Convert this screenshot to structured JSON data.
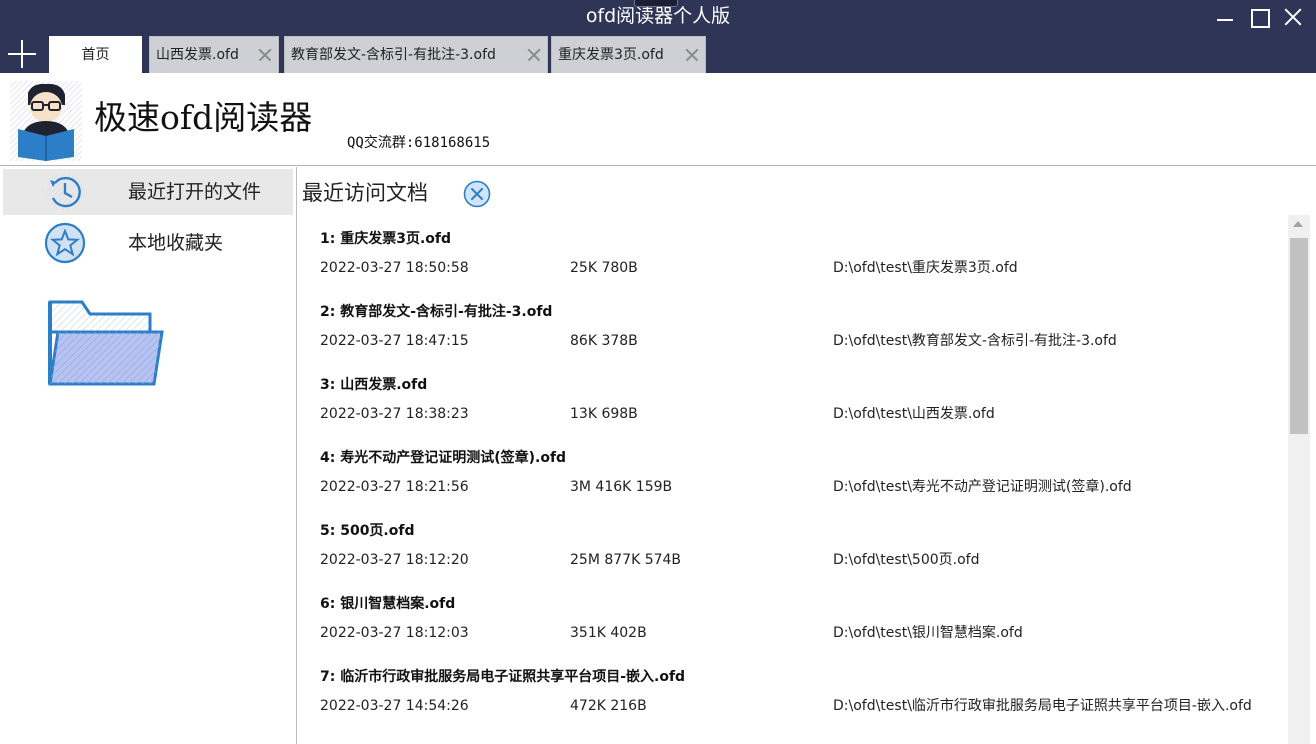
{
  "window": {
    "title": "ofd阅读器个人版"
  },
  "tabs": [
    {
      "label": "首页",
      "active": true
    },
    {
      "label": "山西发票.ofd",
      "active": false
    },
    {
      "label": "教育部发文-含标引-有批注-3.ofd",
      "active": false
    },
    {
      "label": "重庆发票3页.ofd",
      "active": false
    }
  ],
  "brand": {
    "app_name": "极速ofd阅读器",
    "qq_group": "QQ交流群:618168615"
  },
  "sidebar": {
    "items": [
      {
        "label": "最近打开的文件",
        "icon": "recent-clock-icon",
        "selected": true
      },
      {
        "label": "本地收藏夹",
        "icon": "star-icon",
        "selected": false
      }
    ],
    "folder_icon": "open-folder-icon"
  },
  "main": {
    "title": "最近访问文档",
    "clear_icon": "clear-circle-x-icon"
  },
  "recent_files": [
    {
      "title": "1: 重庆发票3页.ofd",
      "time": "2022-03-27 18:50:58",
      "size": "25K 780B",
      "path": "D:\\ofd\\test\\重庆发票3页.ofd"
    },
    {
      "title": "2: 教育部发文-含标引-有批注-3.ofd",
      "time": "2022-03-27 18:47:15",
      "size": "86K 378B",
      "path": "D:\\ofd\\test\\教育部发文-含标引-有批注-3.ofd"
    },
    {
      "title": "3: 山西发票.ofd",
      "time": "2022-03-27 18:38:23",
      "size": "13K 698B",
      "path": "D:\\ofd\\test\\山西发票.ofd"
    },
    {
      "title": "4: 寿光不动产登记证明测试(签章).ofd",
      "time": "2022-03-27 18:21:56",
      "size": "3M 416K 159B",
      "path": "D:\\ofd\\test\\寿光不动产登记证明测试(签章).ofd"
    },
    {
      "title": "5: 500页.ofd",
      "time": "2022-03-27 18:12:20",
      "size": "25M 877K 574B",
      "path": "D:\\ofd\\test\\500页.ofd"
    },
    {
      "title": "6: 银川智慧档案.ofd",
      "time": "2022-03-27 18:12:03",
      "size": "351K 402B",
      "path": "D:\\ofd\\test\\银川智慧档案.ofd"
    },
    {
      "title": "7: 临沂市行政审批服务局电子证照共享平台项目-嵌入.ofd",
      "time": "2022-03-27 14:54:26",
      "size": "472K 216B",
      "path": "D:\\ofd\\test\\临沂市行政审批服务局电子证照共享平台项目-嵌入.ofd"
    }
  ],
  "colors": {
    "titlebar": "#2e3557",
    "tab_inactive": "#cfd0d6",
    "tab_active": "#ffffff",
    "sidebar_selected": "#e8e8e8",
    "icon_blue": "#2c7fc7"
  }
}
